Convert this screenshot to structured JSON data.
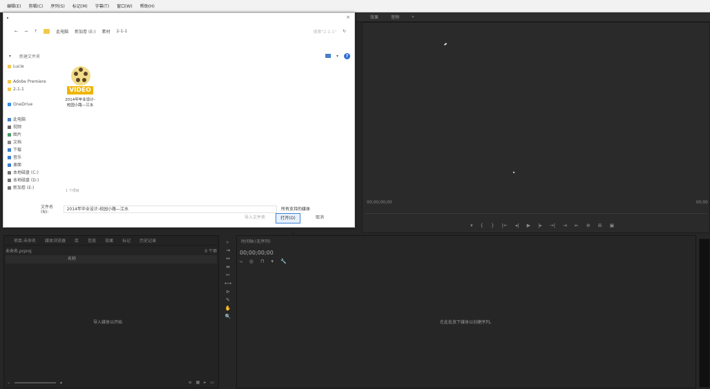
{
  "menubar": {
    "items": [
      "编辑(E)",
      "剪辑(C)",
      "序列(S)",
      "标记(M)",
      "字幕(T)",
      "窗口(W)",
      "帮助(H)"
    ]
  },
  "program_monitor": {
    "tabs": [
      "效果",
      "音频",
      "»"
    ],
    "timecode_left": "00;00;00;00",
    "timecode_right": "00;00",
    "controls": [
      "▾",
      "{",
      "}",
      "|←",
      "◂|",
      "▶",
      "|▸",
      "→|",
      "⇥",
      "⇤",
      "⊕",
      "⊞",
      "▣"
    ]
  },
  "project_panel": {
    "tabs": [
      "项目:未命名",
      "媒体浏览器",
      "库",
      "信息",
      "效果",
      "标记",
      "历史记录"
    ],
    "sub_left": "未命名.prproj",
    "sub_right": "0 个项",
    "column_header": "名称",
    "empty_text": "导入媒体以开始",
    "bottom_icons": [
      "≡",
      "▦",
      "▸",
      "▭"
    ]
  },
  "toolbar": {
    "tools": [
      "▹",
      "⇥",
      "↔",
      "⇹",
      "✂",
      "⟷",
      "⊳",
      "✎",
      "✋",
      "🔍"
    ]
  },
  "timeline": {
    "tab": "时间轴:(无序列)",
    "timecode": "00;00;00;00",
    "tools": [
      "⤷",
      "◎",
      "⊓",
      "▾",
      "🔧"
    ],
    "empty_text": "在此处放下媒体以创建序列。"
  },
  "dialog": {
    "close": "×",
    "address": {
      "nav": [
        "←",
        "→",
        "↑"
      ],
      "crumbs": [
        "此电脑",
        "新加卷 (E:)",
        "素材",
        "2-1-1"
      ],
      "search_placeholder": "搜索\"2-1-1\"",
      "refresh": "↻"
    },
    "cmdbar": {
      "organize": "▾",
      "new_folder": "新建文件夹",
      "view_icon": "view-options-icon",
      "help": "?"
    },
    "navpane": [
      {
        "label": "Lucie",
        "icon": "folder-icon"
      },
      {
        "label": "",
        "icon": ""
      },
      {
        "label": "Adobe Premiere",
        "icon": "folder-icon"
      },
      {
        "label": "2-1-1",
        "icon": "folder-icon"
      },
      {
        "label": "",
        "icon": ""
      },
      {
        "label": "OneDrive",
        "icon": "cloud-icon"
      },
      {
        "label": "",
        "icon": ""
      },
      {
        "label": "此电脑",
        "icon": "computer-icon"
      },
      {
        "label": "视频",
        "icon": "video-icon"
      },
      {
        "label": "图片",
        "icon": "picture-icon"
      },
      {
        "label": "文档",
        "icon": "document-icon"
      },
      {
        "label": "下载",
        "icon": "download-icon"
      },
      {
        "label": "音乐",
        "icon": "music-icon"
      },
      {
        "label": "桌面",
        "icon": "desktop-icon"
      },
      {
        "label": "本地磁盘 (C:)",
        "icon": "drive-icon"
      },
      {
        "label": "本地磁盘 (D:)",
        "icon": "drive-icon"
      },
      {
        "label": "新加卷 (E:)",
        "icon": "drive-icon"
      }
    ],
    "file": {
      "tag": "VIDEO",
      "name_line1": "2014年毕业设计-",
      "name_line2": "校园小路—江水"
    },
    "status_count": "1 个项目",
    "filename_label": "文件名(N):",
    "filename_value": "2014年毕业设计-校园小路—江水",
    "filetype": "所有支持的媒体",
    "buttons": {
      "import": "导入文件夹",
      "open": "打开(O)",
      "cancel": "取消"
    }
  }
}
